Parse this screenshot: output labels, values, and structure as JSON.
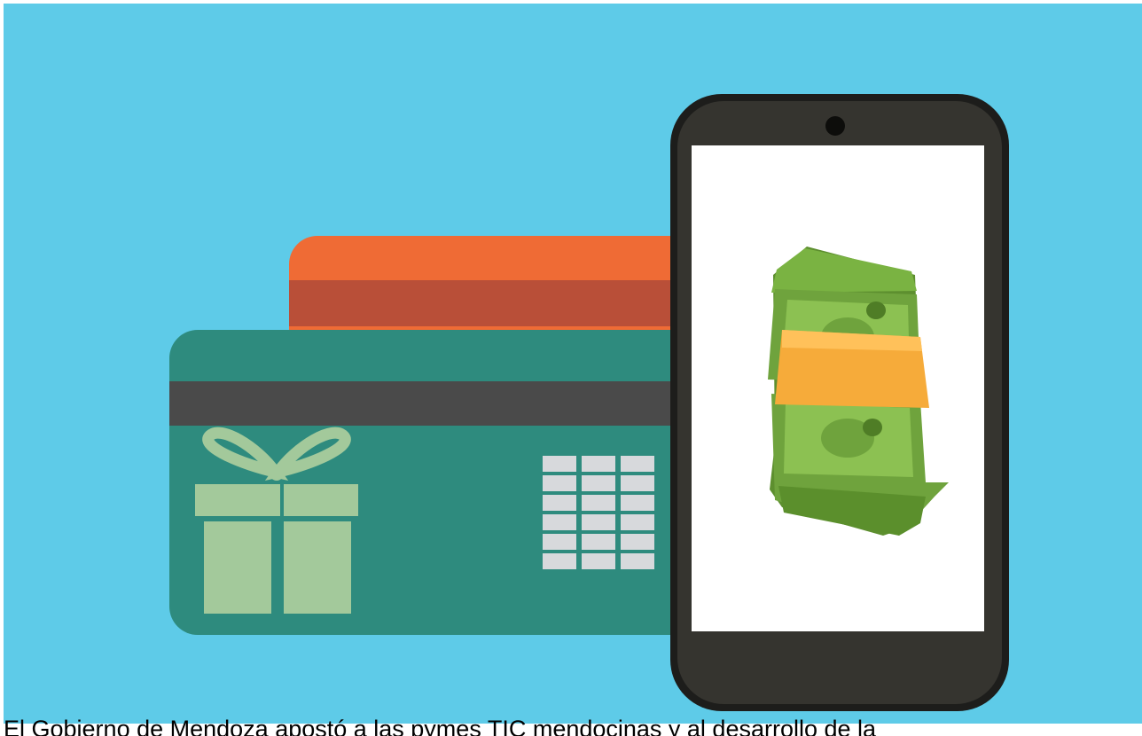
{
  "caption": {
    "text": "El Gobierno de Mendoza apostó a las pymes TIC mendocinas y al desarrollo de la"
  },
  "colors": {
    "background": "#5ecbe8",
    "card_back": "#ef6b35",
    "card_back_stripe": "#b94f38",
    "card_front": "#2e8b7e",
    "card_front_stripe": "#4a4a4a",
    "gift": "#a3c99b",
    "keypad": "#d7d9dc",
    "phone_body": "#2b2b27",
    "phone_screen": "#ffffff",
    "money_green": "#6fa33d",
    "money_band": "#f6ab3a"
  },
  "icons": {
    "card_back": "credit-card-icon",
    "card_front": "gift-card-icon",
    "gift": "gift-icon",
    "keypad": "keypad-icon",
    "phone": "smartphone-icon",
    "money": "money-stack-icon"
  }
}
